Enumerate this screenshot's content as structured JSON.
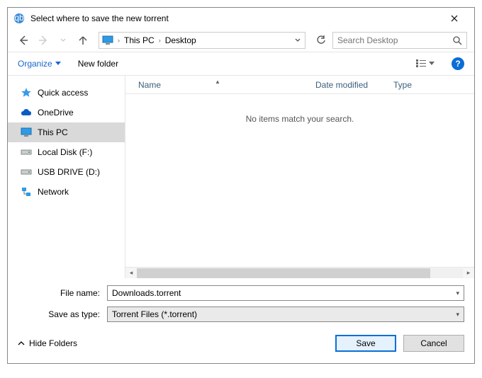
{
  "window": {
    "title": "Select where to save the new torrent"
  },
  "address": {
    "crumbs": [
      "This PC",
      "Desktop"
    ]
  },
  "search": {
    "placeholder": "Search Desktop"
  },
  "toolbar": {
    "organize": "Organize",
    "new_folder": "New folder"
  },
  "tree": {
    "items": [
      {
        "label": "Quick access",
        "icon": "star"
      },
      {
        "label": "OneDrive",
        "icon": "cloud"
      },
      {
        "label": "This PC",
        "icon": "pc",
        "selected": true
      },
      {
        "label": "Local Disk (F:)",
        "icon": "disk"
      },
      {
        "label": "USB DRIVE (D:)",
        "icon": "disk"
      },
      {
        "label": "Network",
        "icon": "network"
      }
    ]
  },
  "columns": {
    "name": "Name",
    "date": "Date modified",
    "type": "Type"
  },
  "list": {
    "empty_text": "No items match your search."
  },
  "form": {
    "filename_label": "File name:",
    "filename_value": "Downloads.torrent",
    "saveas_label": "Save as type:",
    "saveas_value": "Torrent Files (*.torrent)"
  },
  "footer": {
    "hide_folders": "Hide Folders",
    "save": "Save",
    "cancel": "Cancel"
  }
}
